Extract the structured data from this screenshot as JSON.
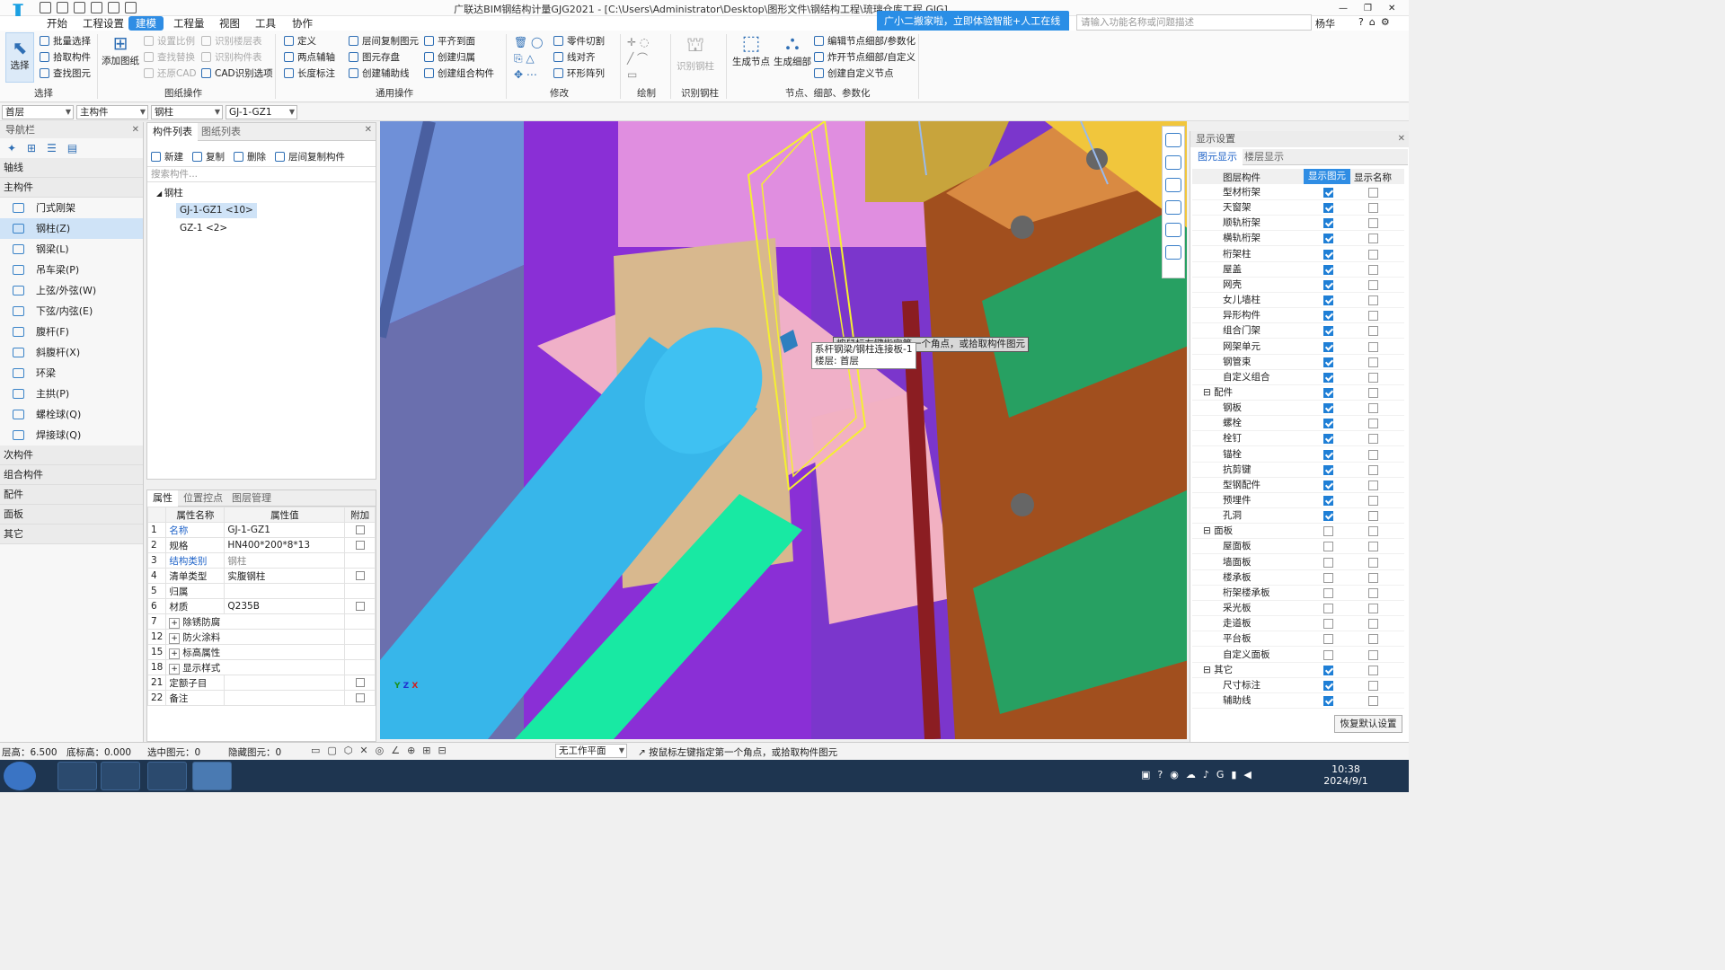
{
  "app": {
    "title": "广联达BIM钢结构计量GJG2021 - [C:\\Users\\Administrator\\Desktop\\图形文件\\钢结构工程\\琉璃仓库工程.GJG]",
    "logo_letter": "I",
    "user": "杨华",
    "window_controls": [
      "—",
      "❐",
      "✕"
    ]
  },
  "menu": [
    "开始",
    "工程设置",
    "建模",
    "工程量",
    "视图",
    "工具",
    "协作"
  ],
  "menu_active": "建模",
  "help_banner": "广小二搬家啦，立即体验智能+人工在线客服",
  "search_placeholder": "请输入功能名称或问题描述",
  "ribbon": {
    "select": {
      "big": "选择",
      "items": [
        "批量选择",
        "拾取构件",
        "查找图元"
      ],
      "label": "选择"
    },
    "drawing_ops": {
      "big": "添加图纸",
      "items": [
        "设置比例",
        "查找替换",
        "还原CAD",
        "识别楼层表",
        "识别构件表",
        "CAD识别选项"
      ],
      "label": "图纸操作"
    },
    "common_ops": {
      "items": [
        "定义",
        "两点辅轴",
        "长度标注",
        "层间复制图元",
        "图元存盘",
        "创建辅助线",
        "平齐到面",
        "创建归属",
        "创建组合构件"
      ],
      "label": "通用操作"
    },
    "modify": {
      "items": [
        "零件切割",
        "线对齐",
        "环形阵列"
      ],
      "label": "修改"
    },
    "draw": {
      "label": "绘制"
    },
    "identify": {
      "big": "识别钢柱",
      "label": "识别钢柱"
    },
    "nodes": {
      "big1": "生成节点",
      "big2": "生成细部",
      "items": [
        "编辑节点细部/参数化",
        "炸开节点细部/自定义",
        "创建自定义节点"
      ],
      "label": "节点、细部、参数化"
    }
  },
  "selectors": [
    "首层",
    "主构件",
    "钢柱",
    "GJ-1-GZ1"
  ],
  "nav": {
    "title": "导航栏",
    "categories": {
      "axis": "轴线",
      "main": "主构件",
      "secondary": "次构件",
      "combo": "组合构件",
      "parts": "配件",
      "panels": "面板",
      "other": "其它"
    },
    "items": [
      "门式刚架",
      "钢柱(Z)",
      "钢梁(L)",
      "吊车梁(P)",
      "上弦/外弦(W)",
      "下弦/内弦(E)",
      "腹杆(F)",
      "斜腹杆(X)",
      "环梁",
      "主拱(P)",
      "螺栓球(Q)",
      "焊接球(Q)"
    ],
    "selected": "钢柱(Z)"
  },
  "component_list": {
    "tabs": [
      "构件列表",
      "图纸列表"
    ],
    "toolbar": [
      "新建",
      "复制",
      "删除",
      "层间复制构件"
    ],
    "search_placeholder": "搜索构件...",
    "root": "钢柱",
    "items": [
      "GJ-1-GZ1 <10>",
      "GZ-1 <2>"
    ]
  },
  "properties": {
    "tabs": [
      "属性",
      "位置控点",
      "图层管理"
    ],
    "headers": [
      "属性名称",
      "属性值",
      "附加"
    ],
    "rows": [
      {
        "no": "1",
        "name": "名称",
        "value": "GJ-1-GZ1"
      },
      {
        "no": "2",
        "name": "规格",
        "value": "HN400*200*8*13"
      },
      {
        "no": "3",
        "name": "结构类别",
        "value": "钢柱"
      },
      {
        "no": "4",
        "name": "清单类型",
        "value": "实腹钢柱"
      },
      {
        "no": "5",
        "name": "归属",
        "value": ""
      },
      {
        "no": "6",
        "name": "材质",
        "value": "Q235B"
      },
      {
        "no": "7",
        "name": "除锈防腐",
        "value": ""
      },
      {
        "no": "12",
        "name": "防火涂料",
        "value": ""
      },
      {
        "no": "15",
        "name": "标高属性",
        "value": ""
      },
      {
        "no": "18",
        "name": "显示样式",
        "value": ""
      },
      {
        "no": "21",
        "name": "定额子目",
        "value": ""
      },
      {
        "no": "22",
        "name": "备注",
        "value": ""
      }
    ]
  },
  "viewport": {
    "tooltip_name": "系杆钢梁/钢柱连接板-1",
    "tooltip_floor": "楼层: 首层",
    "prompt_bg": "按鼠标左键指定第一个角点，或拾取构件图元"
  },
  "display": {
    "title": "显示设置",
    "tabs": [
      "图元显示",
      "楼层显示"
    ],
    "headers": [
      "图层构件",
      "显示图元",
      "显示名称"
    ],
    "rows": [
      {
        "t": "item",
        "label": "型材桁架",
        "a": true
      },
      {
        "t": "item",
        "label": "天窗架",
        "a": true
      },
      {
        "t": "item",
        "label": "顺轨桁架",
        "a": true
      },
      {
        "t": "item",
        "label": "横轨桁架",
        "a": true
      },
      {
        "t": "item",
        "label": "桁架柱",
        "a": true
      },
      {
        "t": "item",
        "label": "屋盖",
        "a": true
      },
      {
        "t": "item",
        "label": "网壳",
        "a": true
      },
      {
        "t": "item",
        "label": "女儿墙柱",
        "a": true
      },
      {
        "t": "item",
        "label": "异形构件",
        "a": true
      },
      {
        "t": "item",
        "label": "组合门架",
        "a": true
      },
      {
        "t": "item",
        "label": "网架单元",
        "a": true
      },
      {
        "t": "item",
        "label": "钢管束",
        "a": true
      },
      {
        "t": "item",
        "label": "自定义组合",
        "a": true
      },
      {
        "t": "cat",
        "label": "配件",
        "a": true
      },
      {
        "t": "item",
        "label": "钢板",
        "a": true
      },
      {
        "t": "item",
        "label": "螺栓",
        "a": true
      },
      {
        "t": "item",
        "label": "栓钉",
        "a": true
      },
      {
        "t": "item",
        "label": "锚栓",
        "a": true
      },
      {
        "t": "item",
        "label": "抗剪键",
        "a": true
      },
      {
        "t": "item",
        "label": "型钢配件",
        "a": true
      },
      {
        "t": "item",
        "label": "预埋件",
        "a": true
      },
      {
        "t": "item",
        "label": "孔洞",
        "a": true
      },
      {
        "t": "cat",
        "label": "面板",
        "a": false
      },
      {
        "t": "item",
        "label": "屋面板",
        "a": false
      },
      {
        "t": "item",
        "label": "墙面板",
        "a": false
      },
      {
        "t": "item",
        "label": "楼承板",
        "a": false
      },
      {
        "t": "item",
        "label": "桁架楼承板",
        "a": false
      },
      {
        "t": "item",
        "label": "采光板",
        "a": false
      },
      {
        "t": "item",
        "label": "走道板",
        "a": false
      },
      {
        "t": "item",
        "label": "平台板",
        "a": false
      },
      {
        "t": "item",
        "label": "自定义面板",
        "a": false
      },
      {
        "t": "cat",
        "label": "其它",
        "a": true
      },
      {
        "t": "item",
        "label": "尺寸标注",
        "a": true
      },
      {
        "t": "item",
        "label": "辅助线",
        "a": true
      }
    ],
    "reset": "恢复默认设置"
  },
  "status": {
    "floor_height": "层高：6.500",
    "bottom_elev": "底标高：0.000",
    "selected": "选中图元：0",
    "hidden": "隐藏图元：0",
    "workplane": "无工作平面",
    "prompt": "按鼠标左键指定第一个角点，或拾取构件图元"
  },
  "taskbar": {
    "time": "10:38",
    "date": "2024/9/1"
  }
}
